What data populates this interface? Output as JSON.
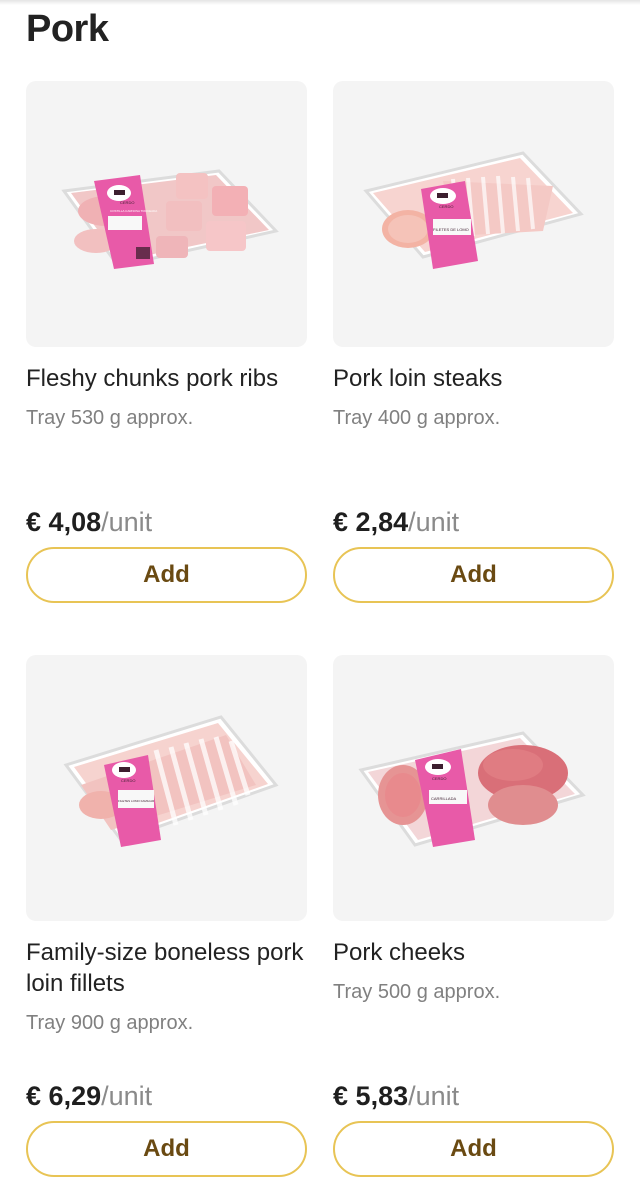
{
  "section": {
    "title": "Pork"
  },
  "currency": "€",
  "products": [
    {
      "name": "Fleshy chunks pork ribs",
      "description": "Tray 530 g approx.",
      "price": "4,08",
      "unit": "/unit",
      "add_label": "Add",
      "label_text": [
        "CERDO",
        "COSTILLA CARNOSA TROCEADA"
      ]
    },
    {
      "name": "Pork loin steaks",
      "description": "Tray 400 g approx.",
      "price": "2,84",
      "unit": "/unit",
      "add_label": "Add",
      "label_text": [
        "CERDO",
        "FILETES DE LOMO"
      ]
    },
    {
      "name": "Family-size boneless pork loin fillets",
      "description": "Tray 900 g approx.",
      "price": "6,29",
      "unit": "/unit",
      "add_label": "Add",
      "label_text": [
        "CERDO",
        "FILETES LOMO FAMILIAR"
      ]
    },
    {
      "name": "Pork cheeks",
      "description": "Tray 500 g approx.",
      "price": "5,83",
      "unit": "/unit",
      "add_label": "Add",
      "label_text": [
        "CERDO",
        "CARRILLADA"
      ]
    }
  ],
  "colors": {
    "accent_border": "#e8c455",
    "button_text": "#6a4a12",
    "image_bg": "#f4f4f4",
    "label_pink": "#e85aa8"
  }
}
